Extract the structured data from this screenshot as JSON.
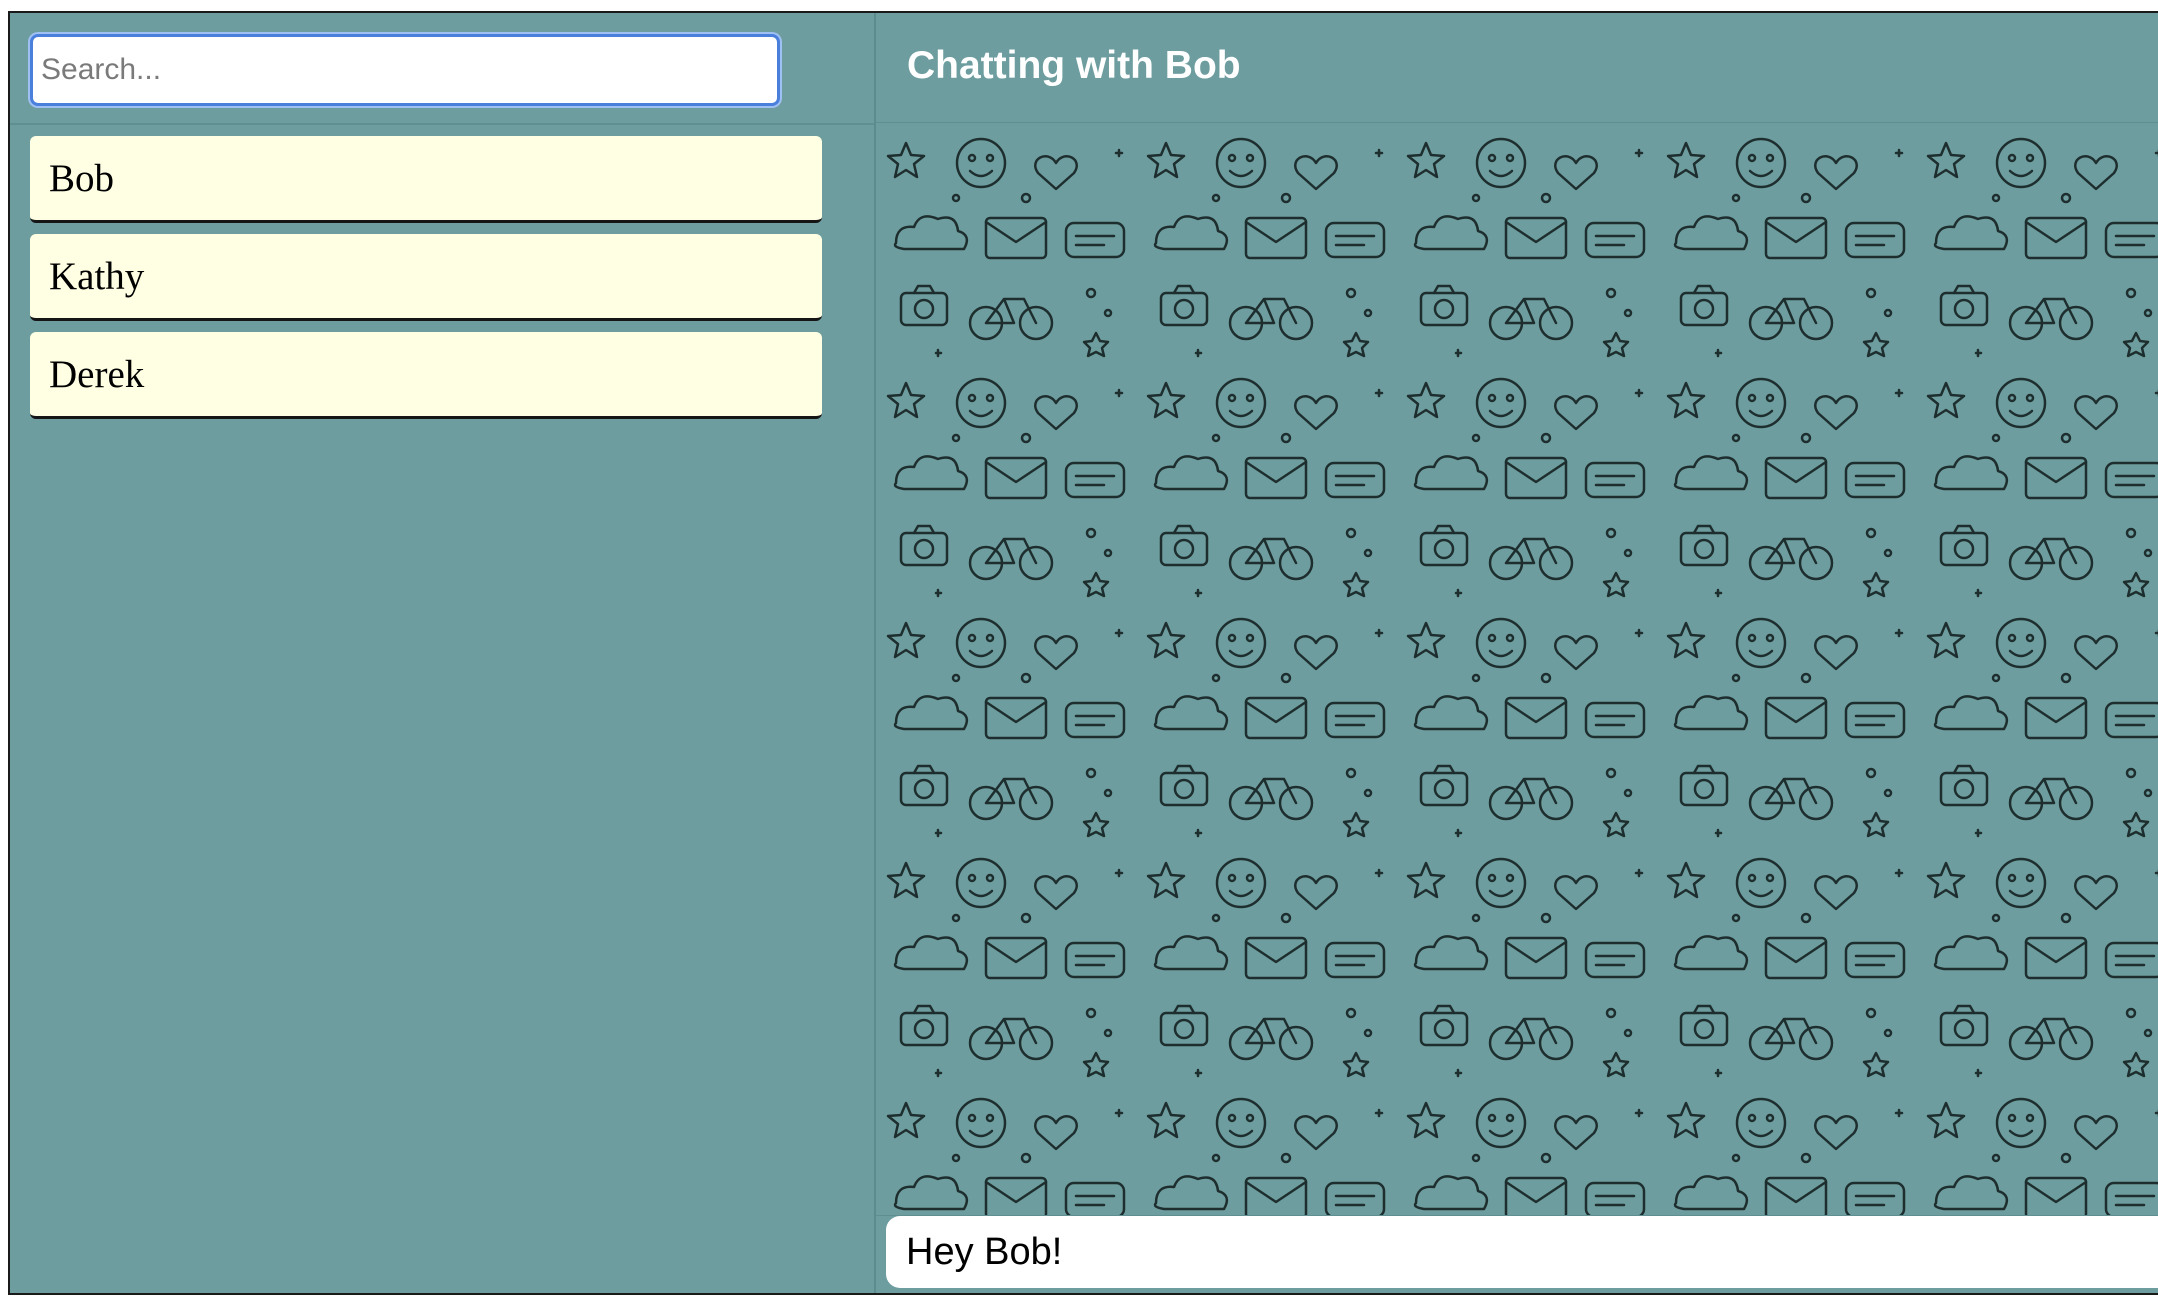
{
  "search": {
    "placeholder": "Search..."
  },
  "contacts": [
    {
      "name": "Bob"
    },
    {
      "name": "Kathy"
    },
    {
      "name": "Derek"
    }
  ],
  "chat": {
    "title": "Chatting with Bob",
    "message_input_value": "Hey Bob!"
  },
  "colors": {
    "background": "#6d9d9f",
    "contact_item": "#ffffe3",
    "search_focus_ring": "#4a7fdc",
    "doodle_stroke": "#1e2e2e"
  },
  "icons": [
    "doodle-wallpaper-pattern"
  ]
}
